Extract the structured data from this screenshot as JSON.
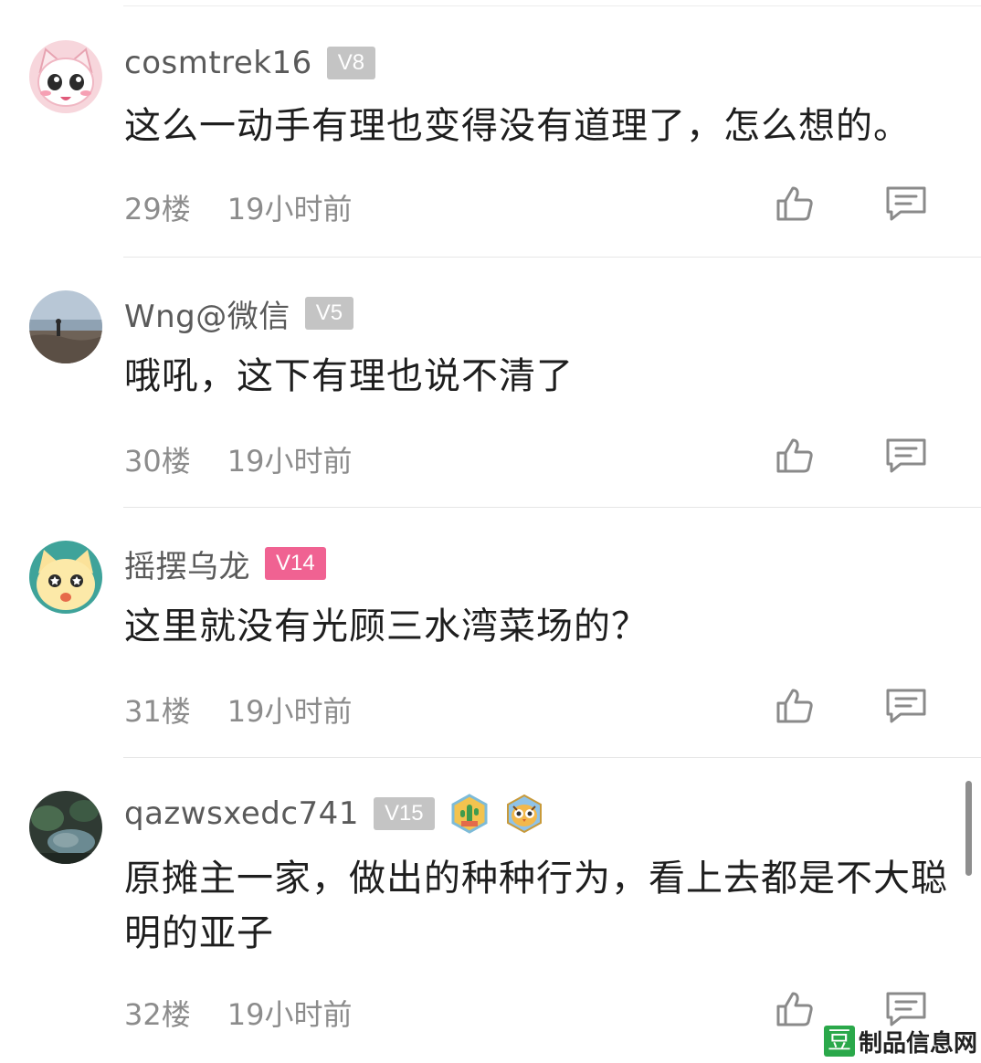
{
  "comments": [
    {
      "username": "cosmtrek16",
      "level": "V8",
      "level_color": "#c4c4c4",
      "text": "这么一动手有理也变得没有道理了，怎么想的。",
      "floor": "29楼",
      "time": "19小时前",
      "avatar": "cartoon-white-cat-pink-avatar"
    },
    {
      "username": "Wng@微信",
      "level": "V5",
      "level_color": "#c4c4c4",
      "text": "哦吼，这下有理也说不清了",
      "floor": "30楼",
      "time": "19小时前",
      "avatar": "seaside-person-photo-avatar"
    },
    {
      "username": "摇摆乌龙",
      "level": "V14",
      "level_color": "#f06292",
      "text": "这里就没有光顾三水湾菜场的？",
      "floor": "31楼",
      "time": "19小时前",
      "avatar": "cartoon-yellow-cat-avatar"
    },
    {
      "username": "qazwsxedc741",
      "level": "V15",
      "level_color": "#c4c4c4",
      "text": "原摊主一家，做出的种种行为，看上去都是不大聪明的亚子",
      "floor": "32楼",
      "time": "19小时前",
      "avatar": "dark-nature-photo-avatar",
      "medals": [
        "cactus-medal-icon",
        "owl-medal-icon"
      ]
    }
  ],
  "watermark": {
    "logo": "豆",
    "text": "制品信息网"
  },
  "colors": {
    "like_icon": "#8a8a8a",
    "reply_icon": "#8a8a8a",
    "meta_text": "#8c8c8c"
  }
}
